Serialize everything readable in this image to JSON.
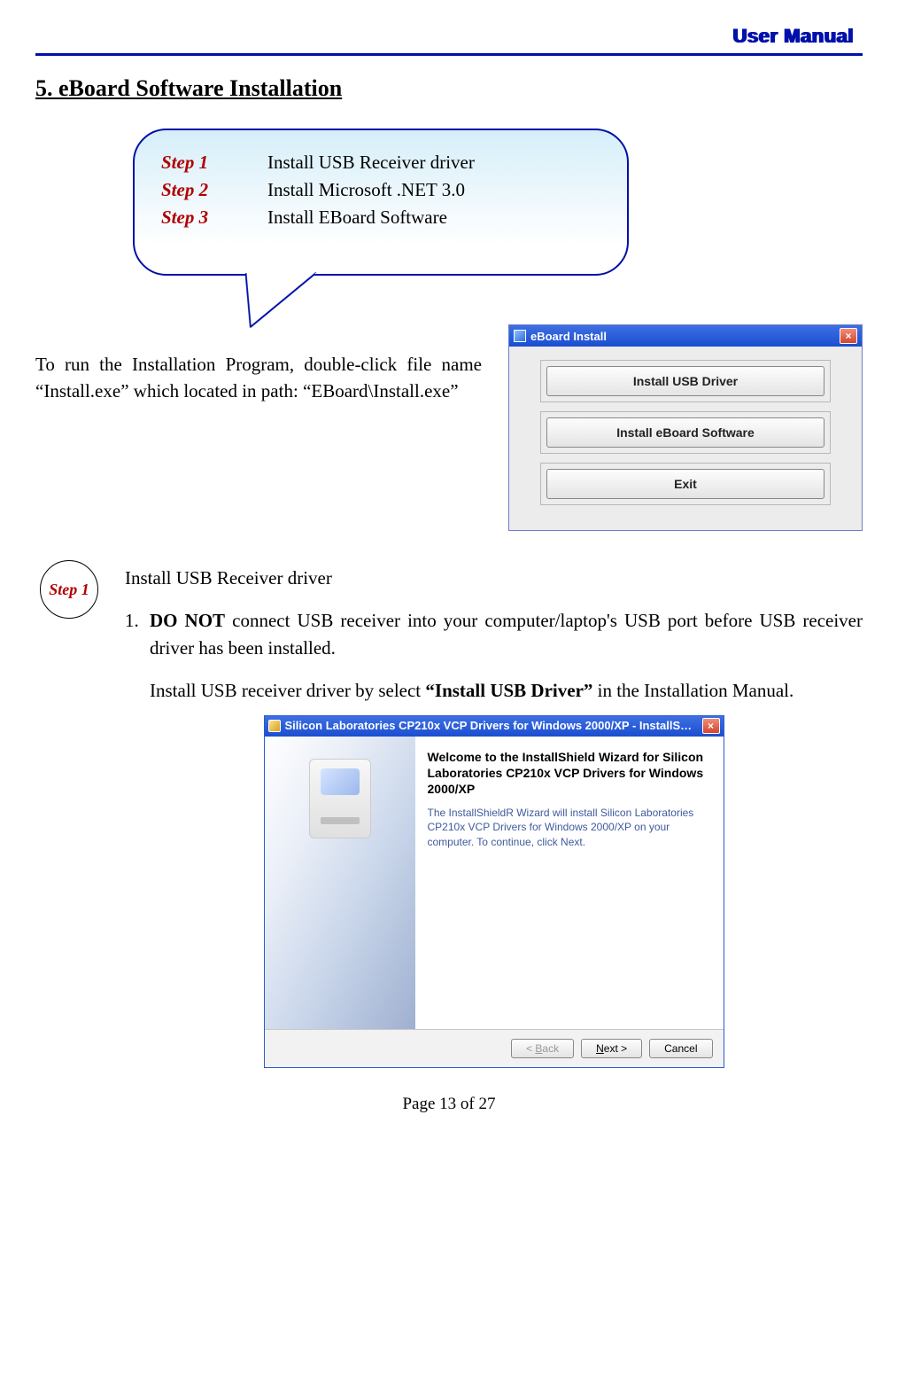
{
  "header": {
    "title": "User Manual"
  },
  "section": {
    "title": "5. eBoard Software Installation"
  },
  "bubble": {
    "steps": [
      {
        "label": "Step 1",
        "desc": "Install USB Receiver driver"
      },
      {
        "label": "Step 2",
        "desc": "Install Microsoft .NET 3.0"
      },
      {
        "label": "Step 3",
        "desc": "Install EBoard Software"
      }
    ]
  },
  "run_text": "To run the Installation Program, double-click file name “Install.exe” which located in path: “EBoard\\Install.exe”",
  "install_dialog": {
    "title": "eBoard Install",
    "btn1": "Install USB Driver",
    "btn2": "Install eBoard Software",
    "btn3": "Exit"
  },
  "step1": {
    "circle": "Step 1",
    "heading": "Install USB Receiver driver",
    "item1_prefix_bold": "DO NOT",
    "item1_rest": " connect USB receiver into your computer/laptop's USB port before USB receiver driver has been installed.",
    "para_pre": "Install USB receiver driver by select ",
    "para_bold": "“Install USB Driver”",
    "para_post": " in the Installation Manual."
  },
  "wizard": {
    "title": "Silicon Laboratories CP210x VCP Drivers for Windows 2000/XP - InstallS…",
    "welcome": "Welcome to the InstallShield Wizard for Silicon Laboratories CP210x VCP Drivers for Windows 2000/XP",
    "text": "The InstallShieldR Wizard will install Silicon Laboratories CP210x VCP Drivers for Windows 2000/XP on your computer.  To continue, click Next.",
    "back": "< Back",
    "next": "Next >",
    "cancel": "Cancel"
  },
  "footer": {
    "page": "Page 13 of 27"
  }
}
